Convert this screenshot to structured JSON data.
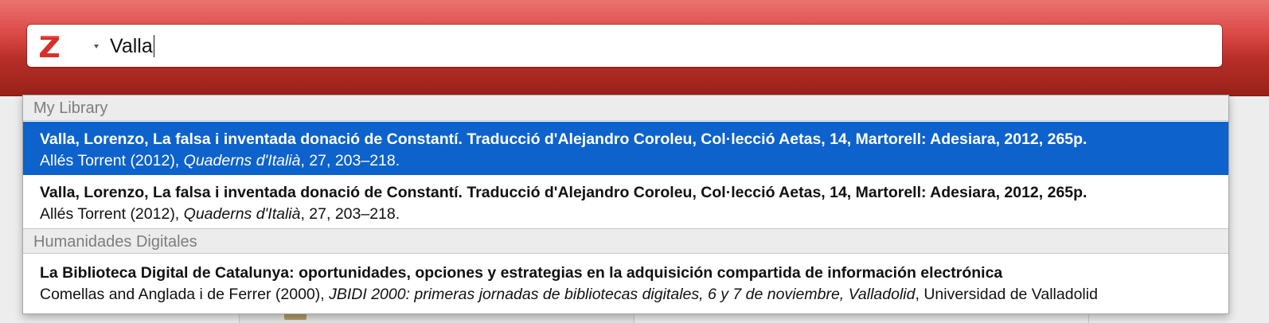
{
  "search": {
    "value": "Valla",
    "logo_letter": "Z"
  },
  "colors": {
    "header_red": "#c5362f",
    "selection_blue": "#0d62cc",
    "group_text": "#7d7d7d"
  },
  "groups": [
    {
      "label": "My Library",
      "results": [
        {
          "title": "Valla, Lorenzo, La falsa i inventada donació de Constantí. Traducció d'Alejandro Coroleu, Col·lecció Aetas, 14, Martorell: Adesiara, 2012, 265p.",
          "meta_before": "Allés Torrent (2012), ",
          "meta_italic": "Quaderns d'Italià",
          "meta_after": ", 27, 203–218.",
          "selected": true
        },
        {
          "title": "Valla, Lorenzo, La falsa i inventada donació de Constantí. Traducció d'Alejandro Coroleu, Col·lecció Aetas, 14, Martorell: Adesiara, 2012, 265p.",
          "meta_before": "Allés Torrent (2012), ",
          "meta_italic": "Quaderns d'Italià",
          "meta_after": ", 27, 203–218.",
          "selected": false
        }
      ]
    },
    {
      "label": "Humanidades Digitales",
      "results": [
        {
          "title": "La Biblioteca Digital de Catalunya: oportunidades, opciones y estrategias en la adquisición compartida de información electrónica",
          "meta_before": "Comellas and Anglada i de Ferrer (2000), ",
          "meta_italic": "JBIDI 2000: primeras jornadas de bibliotecas digitales, 6 y 7 de noviembre, Valladolid",
          "meta_after": ", Universidad de Valladolid",
          "selected": false
        }
      ]
    }
  ]
}
